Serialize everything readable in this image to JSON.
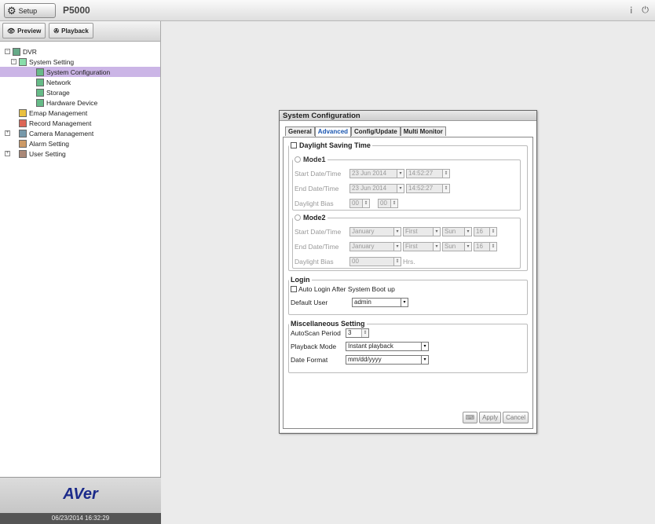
{
  "topbar": {
    "setup_label": "Setup",
    "app_title": "P5000"
  },
  "modes": {
    "preview": "Preview",
    "playback": "Playback"
  },
  "tree": {
    "dvr": "DVR",
    "system_setting": "System Setting",
    "system_configuration": "System Configuration",
    "network": "Network",
    "storage": "Storage",
    "hardware_device": "Hardware Device",
    "emap_management": "Emap Management",
    "record_management": "Record Management",
    "camera_management": "Camera Management",
    "alarm_setting": "Alarm Setting",
    "user_setting": "User Setting"
  },
  "branding": {
    "logo": "AVer",
    "clock": "06/23/2014 16:32:29"
  },
  "panel": {
    "title": "System Configuration",
    "tabs": [
      "General",
      "Advanced",
      "Config/Update",
      "Multi Monitor"
    ],
    "dst": {
      "legend": "Daylight Saving Time",
      "mode1": {
        "legend": "Mode1",
        "start_label": "Start Date/Time",
        "start_date": "23 Jun 2014",
        "start_time": "14:52:27",
        "end_label": "End Date/Time",
        "end_date": "23 Jun 2014",
        "end_time": "14:52:27",
        "bias_label": "Daylight Bias",
        "bias_h": "00",
        "bias_m": "00"
      },
      "mode2": {
        "legend": "Mode2",
        "start_label": "Start Date/Time",
        "start_month": "January",
        "start_week": "First",
        "start_day": "Sun",
        "start_hour": "16",
        "end_label": "End Date/Time",
        "end_month": "January",
        "end_week": "First",
        "end_day": "Sun",
        "end_hour": "16",
        "bias_label": "Daylight Bias",
        "bias": "00",
        "hrs": "Hrs."
      }
    },
    "login": {
      "legend": "Login",
      "auto_login": "Auto Login After System Boot up",
      "default_user_label": "Default User",
      "default_user": "admin"
    },
    "misc": {
      "legend": "Miscellaneous Setting",
      "autoscan_label": "AutoScan Period",
      "autoscan_value": "3",
      "playback_label": "Playback Mode",
      "playback_value": "Instant playback",
      "date_label": "Date Format",
      "date_value": "mm/dd/yyyy"
    },
    "buttons": {
      "apply": "Apply",
      "cancel": "Cancel"
    }
  }
}
